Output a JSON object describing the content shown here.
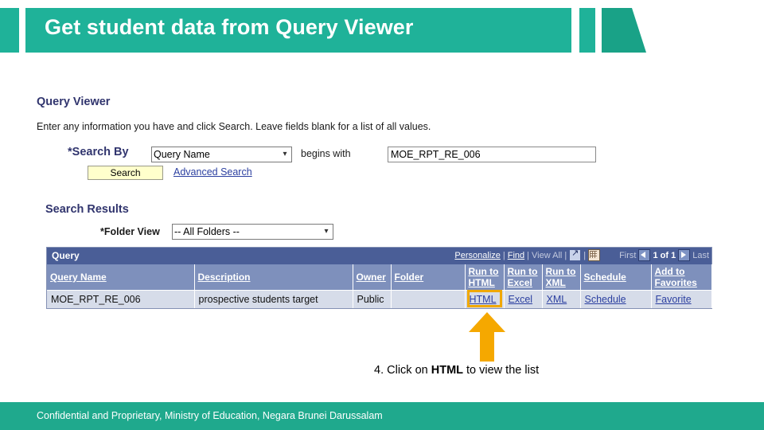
{
  "slide": {
    "title": "Get student data from Query Viewer",
    "accent_color": "#1FB299",
    "footer_color": "#1FA98D",
    "footer_text": "Confidential and Proprietary, Ministry of Education, Negara Brunei Darussalam"
  },
  "app": {
    "pagelet_title": "Query Viewer",
    "instruction": "Enter any information you have and click Search. Leave fields blank for a list of all values.",
    "search_by": {
      "label": "*Search By",
      "selected_option": "Query Name",
      "operator_label": "begins with",
      "value": "MOE_RPT_RE_006",
      "placeholder": "",
      "search_button": "Search",
      "advanced_search_link": "Advanced Search"
    },
    "search_results": {
      "title": "Search Results",
      "folder_view_label": "*Folder View",
      "folder_view_selected": "-- All Folders --"
    },
    "grid": {
      "title": "Query",
      "toolbar": {
        "personalize": "Personalize",
        "find": "Find",
        "view_all": "View All",
        "sep": "|",
        "expand_icon": "expand-icon",
        "grid_icon": "download-grid-icon",
        "first": "First",
        "prev_icon": "prev-arrow-icon",
        "page_indicator": "1 of 1",
        "next_icon": "next-arrow-icon",
        "last": "Last"
      },
      "columns": [
        "Query Name",
        "Description",
        "Owner",
        "Folder",
        "Run to HTML",
        "Run to Excel",
        "Run to XML",
        "Schedule",
        "Add to Favorites"
      ],
      "rows": [
        {
          "query_name": "MOE_RPT_RE_006",
          "description": "prospective students target",
          "owner": "Public",
          "folder": "",
          "run_html": "HTML",
          "run_excel": "Excel",
          "run_xml": "XML",
          "schedule": "Schedule",
          "favorite": "Favorite"
        }
      ],
      "highlight_color": "#F0A800"
    }
  },
  "callout": {
    "arrow_color": "#F5A800",
    "caption_prefix": "4. Click on ",
    "caption_bold": "HTML",
    "caption_suffix": " to view the list"
  }
}
